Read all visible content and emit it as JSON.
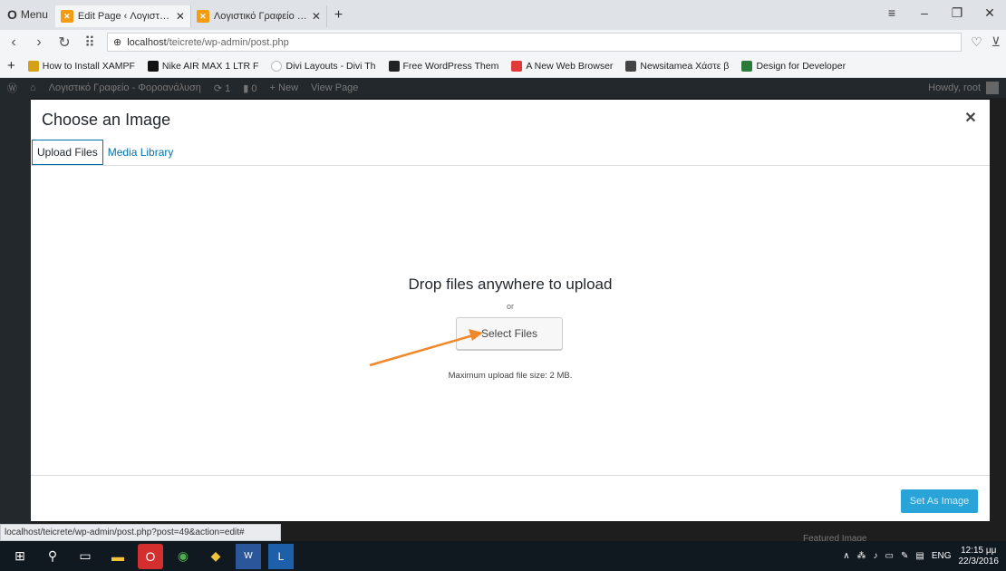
{
  "browser": {
    "menu_label": "Menu",
    "tabs": [
      {
        "label": "Edit Page ‹ Λογιστικό Γραφ…"
      },
      {
        "label": "Λογιστικό Γραφείο – Φορ…"
      }
    ],
    "url_host": "localhost",
    "url_path": "/teicrete/wp-admin/post.php",
    "bookmarks": [
      {
        "label": "How to Install XAMPF",
        "color": "#d4a017"
      },
      {
        "label": "Nike AIR MAX 1 LTR F",
        "color": "#111111"
      },
      {
        "label": "Divi Layouts - Divi Th",
        "color": "#bbbbbb"
      },
      {
        "label": "Free WordPress Them",
        "color": "#222222"
      },
      {
        "label": "A New Web Browser",
        "color": "#e03a3a"
      },
      {
        "label": "Newsitamea Χάστε β",
        "color": "#444444"
      },
      {
        "label": "Design for Developer",
        "color": "#2a7a3a"
      }
    ]
  },
  "wp_bar": {
    "site_name": "Λογιστικό Γραφείο - Φοροανάλυση",
    "updates": "1",
    "comments": "0",
    "new_label": "New",
    "view_label": "View Page",
    "howdy": "Howdy, root"
  },
  "modal": {
    "title": "Choose an Image",
    "tabs": [
      "Upload Files",
      "Media Library"
    ],
    "drop_text": "Drop files anywhere to upload",
    "or_text": "or",
    "select_button": "Select Files",
    "max_size": "Maximum upload file size: 2 MB.",
    "set_button": "Set As Image"
  },
  "status_url": "localhost/teicrete/wp-admin/post.php?post=49&action=edit#",
  "background_text": "Featured Image",
  "taskbar": {
    "lang": "ENG",
    "time": "12:15 μμ",
    "date": "22/3/2016"
  },
  "colors": {
    "accent": "#0073aa",
    "annotation_arrow": "#f0882a",
    "primary_button": "#29a4d8"
  }
}
